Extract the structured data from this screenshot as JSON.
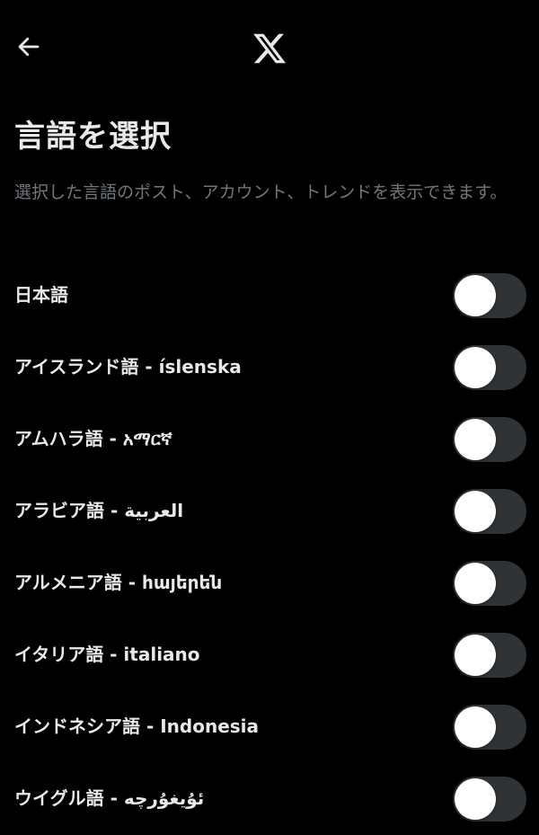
{
  "header": {
    "back_icon": "arrow-left-icon",
    "logo_icon": "x-logo-icon"
  },
  "page": {
    "title": "言語を選択",
    "description": "選択した言語のポスト、アカウント、トレンドを表示できます。"
  },
  "languages": [
    {
      "label": "日本語",
      "enabled": false
    },
    {
      "label": "アイスランド語 - íslenska",
      "enabled": false
    },
    {
      "label": "アムハラ語 - አማርኛ",
      "enabled": false
    },
    {
      "label": "アラビア語 - العربية",
      "enabled": false
    },
    {
      "label": "アルメニア語 - հայերեն",
      "enabled": false
    },
    {
      "label": "イタリア語 - italiano",
      "enabled": false
    },
    {
      "label": "インドネシア語 - Indonesia",
      "enabled": false
    },
    {
      "label": "ウイグル語 - ئۇيغۇرچە",
      "enabled": false
    }
  ],
  "colors": {
    "background": "#000000",
    "text_primary": "#e7e9ea",
    "text_secondary": "#71767b",
    "toggle_off_track": "#2f3336",
    "toggle_knob": "#ffffff"
  }
}
